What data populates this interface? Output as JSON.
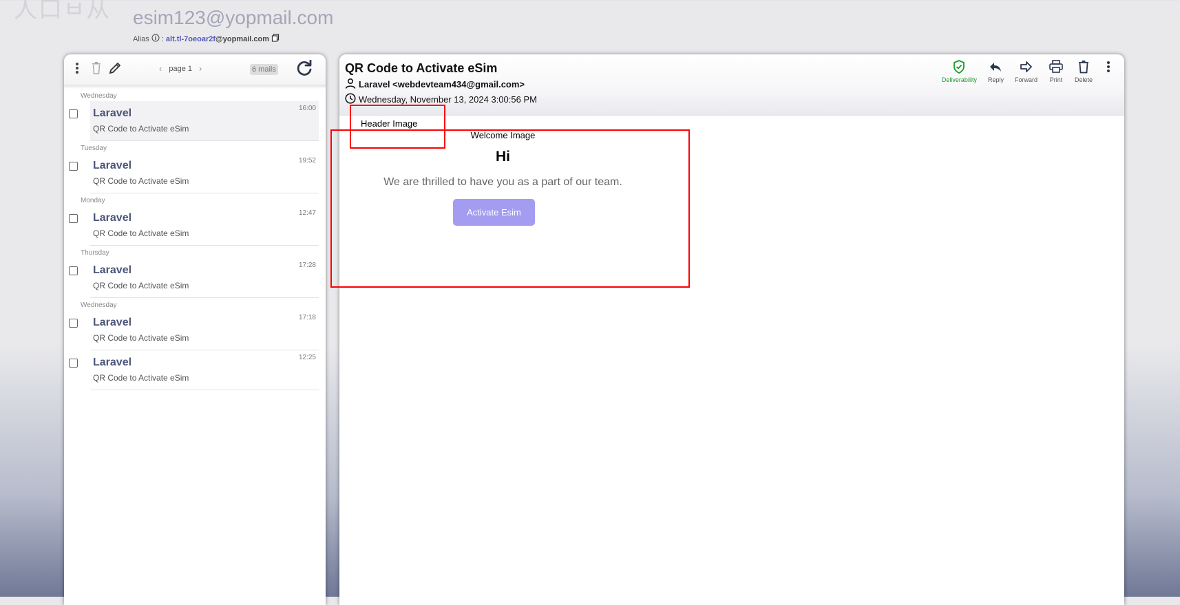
{
  "logo_text": "人口ㅂ从",
  "inbox": {
    "email": "esim123@yopmail.com",
    "alias_label": "Alias",
    "alias_sep": ":",
    "alias_name": "alt.tl-7oeoar2f",
    "alias_domain": "@yopmail.com"
  },
  "list": {
    "page_label": "page 1",
    "mail_count": "6 mails",
    "groups": [
      {
        "day": "Wednesday",
        "from": "Laravel",
        "subject": "QR Code to Activate eSim",
        "time": "16:00"
      },
      {
        "day": "Tuesday",
        "from": "Laravel",
        "subject": "QR Code to Activate eSim",
        "time": "19:52"
      },
      {
        "day": "Monday",
        "from": "Laravel",
        "subject": "QR Code to Activate eSim",
        "time": "12:47"
      },
      {
        "day": "Thursday",
        "from": "Laravel",
        "subject": "QR Code to Activate eSim",
        "time": "17:28"
      },
      {
        "day": "Wednesday",
        "from": "Laravel",
        "subject": "QR Code to Activate eSim",
        "time": "17:18"
      },
      {
        "day": "",
        "from": "Laravel",
        "subject": "QR Code to Activate eSim",
        "time": "12:25"
      }
    ]
  },
  "message": {
    "subject": "QR Code to Activate eSim",
    "from": "Laravel <webdevteam434@gmail.com>",
    "date": "Wednesday, November 13, 2024 3:00:56 PM",
    "actions": {
      "deliverability": "Deliverability",
      "reply": "Reply",
      "forward": "Forward",
      "print": "Print",
      "delete": "Delete"
    },
    "body": {
      "header_image_alt": "Header Image",
      "welcome_image_alt": "Welcome Image",
      "greeting": "Hi",
      "text": "We are thrilled to have you as a part of our team.",
      "button": "Activate Esim"
    }
  },
  "colors": {
    "accent": "#5457b8",
    "button": "#a39cf0",
    "deliverability": "#1b9a2a",
    "highlight_border": "#ff0000"
  }
}
